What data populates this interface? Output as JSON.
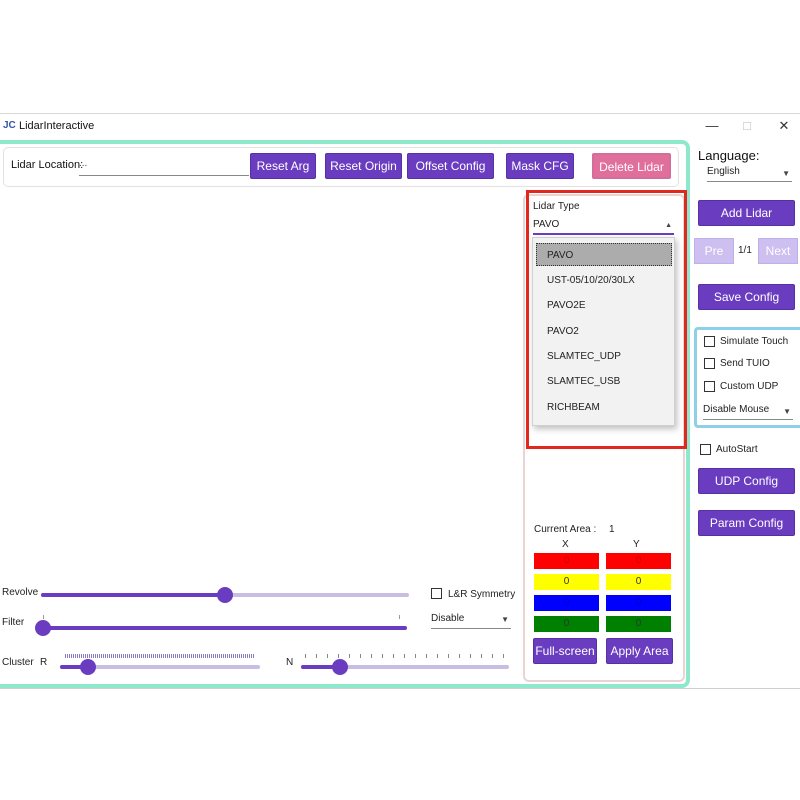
{
  "window": {
    "title": "LidarInteractive",
    "app_icon_text": "JC",
    "minimize_glyph": "—",
    "maximize_glyph": "□",
    "close_glyph": "✕"
  },
  "location": {
    "label": "Lidar Location:",
    "value": "..."
  },
  "toolbar": {
    "reset_arg": "Reset Arg",
    "reset_origin": "Reset Origin",
    "offset_config": "Offset Config",
    "mask_cfg": "Mask CFG",
    "delete_lidar": "Delete Lidar"
  },
  "controls": {
    "revolve_label": "Revolve",
    "filter_label": "Filter",
    "cluster_label": "Cluster",
    "cluster_r_label": "R",
    "cluster_n_label": "N",
    "symmetry_label": "L&R Symmetry",
    "filter_select": "Disable"
  },
  "sliders": {
    "revolve_level": 0.5,
    "filter_level": 0.0,
    "cluster_r_level": 0.1,
    "cluster_n_level": 0.2
  },
  "lidar_type": {
    "label": "Lidar Type",
    "selected": "PAVO",
    "options": [
      "PAVO",
      "UST-05/10/20/30LX",
      "PAVO2E",
      "PAVO2",
      "SLAMTEC_UDP",
      "SLAMTEC_USB",
      "RICHBEAM"
    ]
  },
  "area": {
    "current_label": "Current Area :",
    "current_value": "1",
    "x_label": "X",
    "y_label": "Y",
    "rows": [
      {
        "color": "#ff0000",
        "x": "0",
        "y": "0"
      },
      {
        "color": "#ffff00",
        "x": "0",
        "y": "0"
      },
      {
        "color": "#0000ff",
        "x": "0",
        "y": "0"
      },
      {
        "color": "#008000",
        "x": "0",
        "y": "0"
      }
    ],
    "fullscreen": "Full-screen",
    "apply": "Apply Area"
  },
  "sidebar": {
    "language_label": "Language:",
    "language_value": "English",
    "add_lidar": "Add Lidar",
    "pre": "Pre",
    "page": "1/1",
    "next": "Next",
    "save_config": "Save Config",
    "simulate_touch": "Simulate Touch",
    "send_tuio": "Send TUIO",
    "custom_udp": "Custom UDP",
    "mouse_mode": "Disable Mouse",
    "autostart": "AutoStart",
    "udp_config": "UDP Config",
    "param_config": "Param Config"
  },
  "colors": {
    "accent": "#6a3dc0",
    "danger_pink": "#e06f9b",
    "highlight_red": "#e1281e",
    "panel_border": "#8ee8cc"
  }
}
